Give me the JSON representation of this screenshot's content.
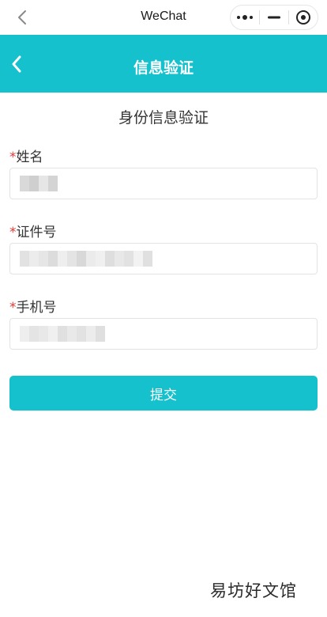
{
  "system_bar": {
    "title": "WeChat",
    "back_icon": "chevron-left-icon",
    "more_icon": "more-dots-icon",
    "minimize_icon": "minimize-icon",
    "close_icon": "target-close-icon"
  },
  "nav": {
    "title": "信息验证",
    "back_icon": "chevron-left-icon",
    "background": "#14c1cc"
  },
  "form": {
    "title": "身份信息验证",
    "required_mark": "*",
    "fields": [
      {
        "label": "姓名",
        "value": ""
      },
      {
        "label": "证件号",
        "value": ""
      },
      {
        "label": "手机号",
        "value": ""
      }
    ],
    "submit_label": "提交"
  },
  "watermark": {
    "text": "易坊好文馆"
  },
  "colors": {
    "accent": "#14c1cc",
    "required": "#e53935"
  }
}
